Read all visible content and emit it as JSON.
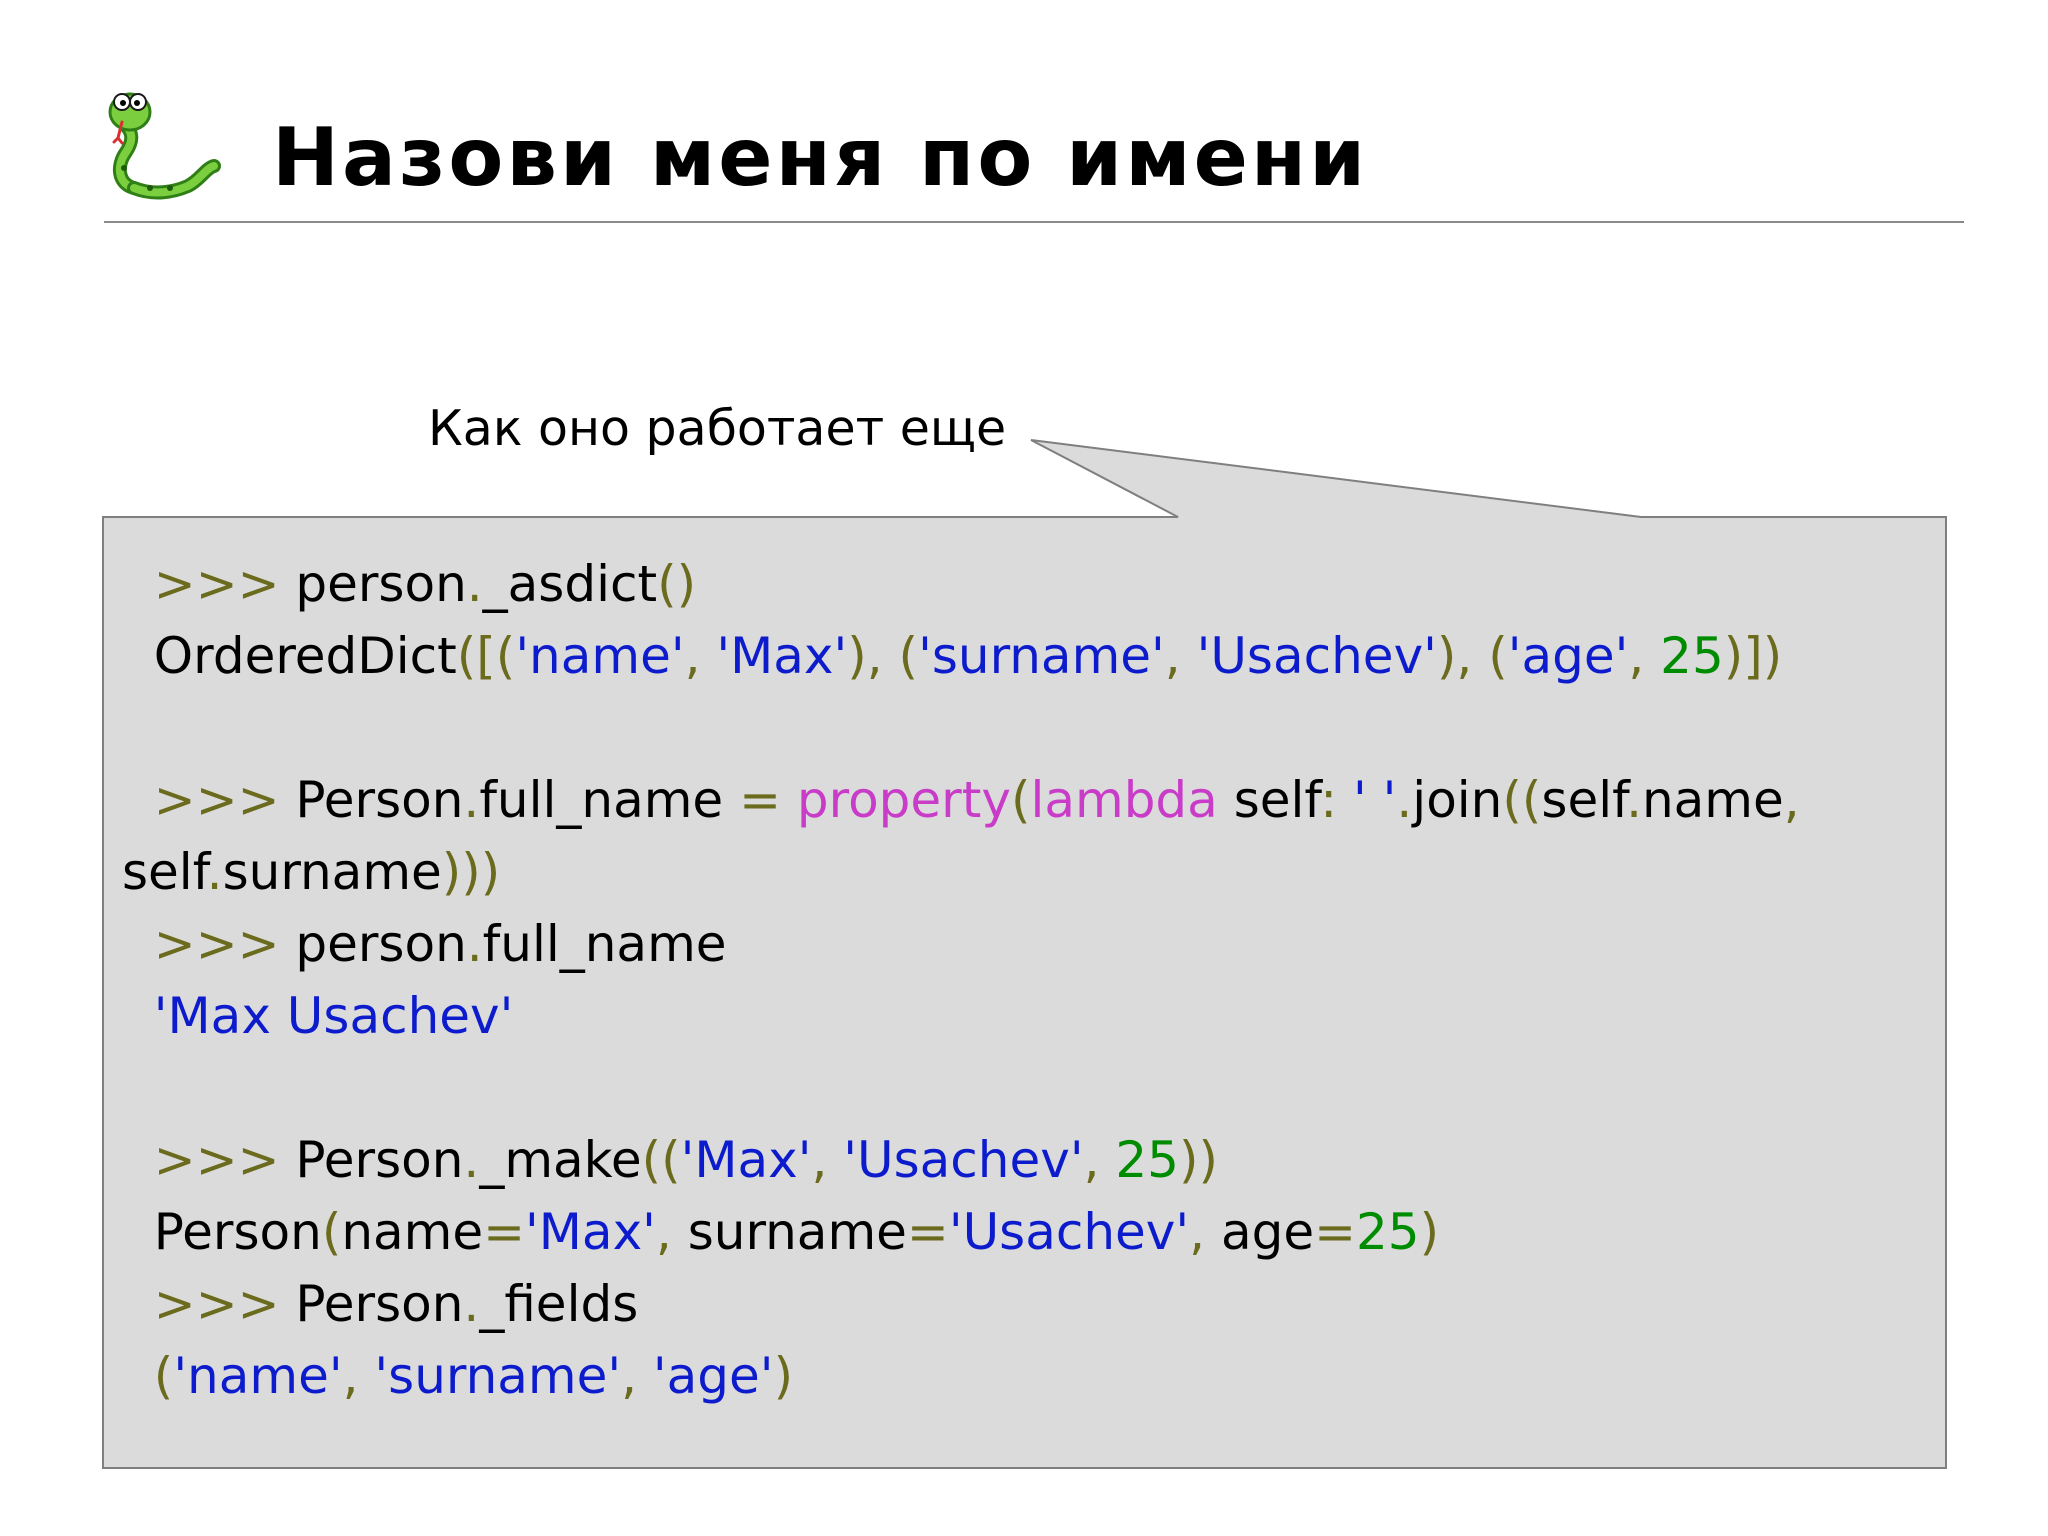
{
  "slide": {
    "title": "Назови меня по имени",
    "callout": "Как оно работает еще",
    "logo": "python-snake-icon"
  },
  "colors": {
    "prompt": "#6b6b1e",
    "string": "#0c1ccc",
    "number": "#008c00",
    "builtin": "#c83cc8",
    "box_fill": "#dcdbdc",
    "box_border": "#7f7f7f"
  },
  "code": {
    "l1": {
      "prompt": ">>> ",
      "a": "person",
      "b": ".",
      "c": "_asdict",
      "d": "()"
    },
    "l2": {
      "a": "OrderedDict",
      "b": "([(",
      "c": "'name'",
      "d": ", ",
      "e": "'Max'",
      "f": "), (",
      "g": "'surname'",
      "h": ", ",
      "i": "'Usachev'",
      "j": "), (",
      "k": "'age'",
      "l": ", ",
      "m": "25",
      "n": ")])"
    },
    "l3": {
      "prompt": ">>> ",
      "a": "Person",
      "b": ".",
      "c": "full_name ",
      "d": "=",
      "e": " ",
      "f": "property",
      "g": "(",
      "h": "lambda",
      "i": " self",
      "j": ":",
      "k": " ",
      "l": "' '",
      "m": ".",
      "n": "join",
      "o": "((",
      "p": "self",
      "q": ".",
      "r": "name",
      "s": ","
    },
    "l4": {
      "a": "self",
      "b": ".",
      "c": "surname",
      "d": ")))"
    },
    "l5": {
      "prompt": ">>> ",
      "a": "person",
      "b": ".",
      "c": "full_name"
    },
    "l6": {
      "a": "'Max Usachev'"
    },
    "l7": {
      "prompt": ">>> ",
      "a": "Person",
      "b": ".",
      "c": "_make",
      "d": "((",
      "e": "'Max'",
      "f": ", ",
      "g": "'Usachev'",
      "h": ", ",
      "i": "25",
      "j": "))"
    },
    "l8": {
      "a": "Person",
      "b": "(",
      "c": "name",
      "d": "=",
      "e": "'Max'",
      "f": ", ",
      "g": "surname",
      "h": "=",
      "i": "'Usachev'",
      "j": ", ",
      "k": "age",
      "l": "=",
      "m": "25",
      "n": ")"
    },
    "l9": {
      "prompt": ">>> ",
      "a": "Person",
      "b": ".",
      "c": "_fields"
    },
    "l10": {
      "a": "(",
      "b": "'name'",
      "c": ", ",
      "d": "'surname'",
      "e": ", ",
      "f": "'age'",
      "g": ")"
    }
  }
}
